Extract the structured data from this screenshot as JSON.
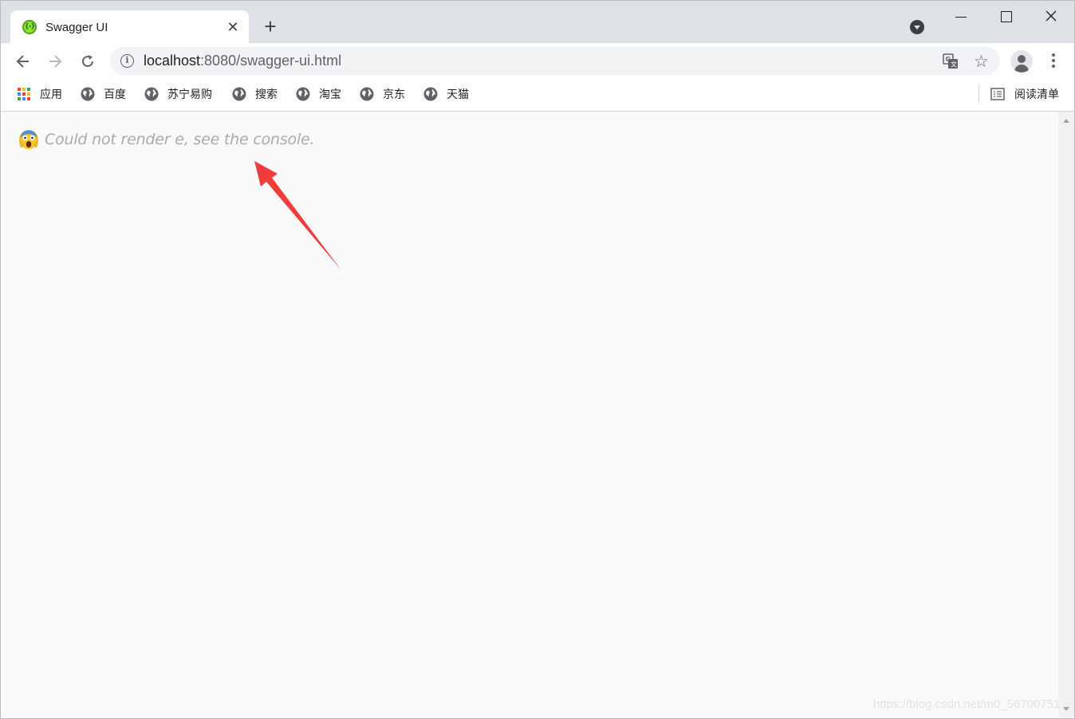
{
  "window": {
    "tab": {
      "title": "Swagger UI",
      "favicon": "swagger-icon"
    },
    "controls": [
      "minimize-icon",
      "maximize-icon",
      "close-icon"
    ]
  },
  "toolbar": {
    "url_host": "localhost",
    "url_rest": ":8080/swagger-ui.html",
    "icons": [
      "back-icon",
      "forward-icon",
      "reload-icon",
      "info-icon",
      "translate-icon",
      "star-icon",
      "profile-avatar",
      "menu-icon"
    ]
  },
  "bookmarks": {
    "items": [
      {
        "label": "应用",
        "icon": "apps-icon"
      },
      {
        "label": "百度",
        "icon": "globe-icon"
      },
      {
        "label": "苏宁易购",
        "icon": "globe-icon"
      },
      {
        "label": "搜索",
        "icon": "globe-icon"
      },
      {
        "label": "淘宝",
        "icon": "globe-icon"
      },
      {
        "label": "京东",
        "icon": "globe-icon"
      },
      {
        "label": "天猫",
        "icon": "globe-icon"
      }
    ],
    "reading_list": "阅读清单"
  },
  "page": {
    "error_message": "Could not render e, see the console.",
    "error_icon": "screaming-face-emoji",
    "annotation": "red-arrow",
    "watermark": "https://blog.csdn.net/m0_56700751"
  },
  "colors": {
    "tabstrip": "#dee1e6",
    "page_bg": "#fafafa",
    "error_text": "#aaaaaa",
    "arrow": "#f03c3c",
    "swagger_green": "#85ea2d"
  }
}
